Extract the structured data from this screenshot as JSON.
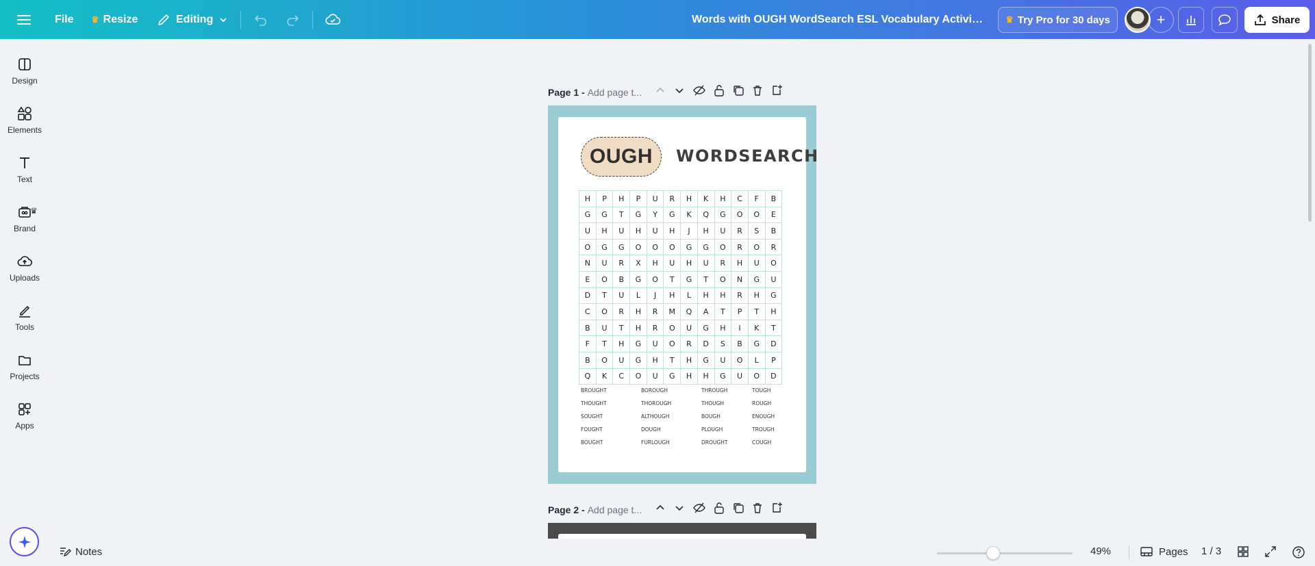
{
  "topbar": {
    "file_label": "File",
    "resize_label": "Resize",
    "editing_label": "Editing",
    "doc_title": "Words with OUGH WordSearch ESL Vocabulary Activity Wor...",
    "pro_label": "Try Pro for 30 days",
    "share_label": "Share"
  },
  "sidebar": {
    "items": [
      {
        "label": "Design"
      },
      {
        "label": "Elements"
      },
      {
        "label": "Text"
      },
      {
        "label": "Brand"
      },
      {
        "label": "Uploads"
      },
      {
        "label": "Tools"
      },
      {
        "label": "Projects"
      },
      {
        "label": "Apps"
      }
    ]
  },
  "pages": [
    {
      "label": "Page 1 -",
      "title_placeholder": "Add page t..."
    },
    {
      "label": "Page 2 -",
      "title_placeholder": "Add page t..."
    }
  ],
  "worksheet": {
    "pill_text": "OUGH",
    "title": "WORDSEARCH",
    "grid": [
      [
        "H",
        "P",
        "H",
        "P",
        "U",
        "R",
        "H",
        "K",
        "H",
        "C",
        "F",
        "B"
      ],
      [
        "G",
        "G",
        "T",
        "G",
        "Y",
        "G",
        "K",
        "Q",
        "G",
        "O",
        "O",
        "E"
      ],
      [
        "U",
        "H",
        "U",
        "H",
        "U",
        "H",
        "J",
        "H",
        "U",
        "R",
        "S",
        "B"
      ],
      [
        "O",
        "G",
        "G",
        "O",
        "O",
        "O",
        "G",
        "G",
        "O",
        "R",
        "O",
        "R"
      ],
      [
        "N",
        "U",
        "R",
        "X",
        "H",
        "U",
        "H",
        "U",
        "R",
        "H",
        "U",
        "O"
      ],
      [
        "E",
        "O",
        "B",
        "G",
        "O",
        "T",
        "G",
        "T",
        "O",
        "N",
        "G",
        "U"
      ],
      [
        "D",
        "T",
        "U",
        "L",
        "J",
        "H",
        "L",
        "H",
        "H",
        "R",
        "H",
        "G"
      ],
      [
        "C",
        "O",
        "R",
        "H",
        "R",
        "M",
        "Q",
        "A",
        "T",
        "P",
        "T",
        "H"
      ],
      [
        "B",
        "U",
        "T",
        "H",
        "R",
        "O",
        "U",
        "G",
        "H",
        "I",
        "K",
        "T"
      ],
      [
        "F",
        "T",
        "H",
        "G",
        "U",
        "O",
        "R",
        "D",
        "S",
        "B",
        "G",
        "D"
      ],
      [
        "B",
        "O",
        "U",
        "G",
        "H",
        "T",
        "H",
        "G",
        "U",
        "O",
        "L",
        "P"
      ],
      [
        "Q",
        "K",
        "C",
        "O",
        "U",
        "G",
        "H",
        "H",
        "G",
        "U",
        "O",
        "D"
      ]
    ],
    "word_columns": [
      [
        "BROUGHT",
        "THOUGHT",
        "SOUGHT",
        "FOUGHT",
        "BOUGHT"
      ],
      [
        "BOROUGH",
        "THOROUGH",
        "ALTHOUGH",
        "DOUGH",
        "FURLOUGH"
      ],
      [
        "THROUGH",
        "THOUGH",
        "BOUGH",
        "PLOUGH",
        "DROUGHT"
      ],
      [
        "TOUGH",
        "ROUGH",
        "ENOUGH",
        "TROUGH",
        "COUGH"
      ]
    ]
  },
  "bottombar": {
    "notes_label": "Notes",
    "zoom": "49%",
    "pages_label": "Pages",
    "page_count": "1 / 3"
  },
  "colors": {
    "topbar_start": "#14c0c6",
    "topbar_end": "#5a5ee8",
    "page1_bg": "#9acdd3",
    "pill_bg": "#f0dcc3",
    "grid_line": "#bfe3e0",
    "page2_bg": "#4b4b4b"
  }
}
